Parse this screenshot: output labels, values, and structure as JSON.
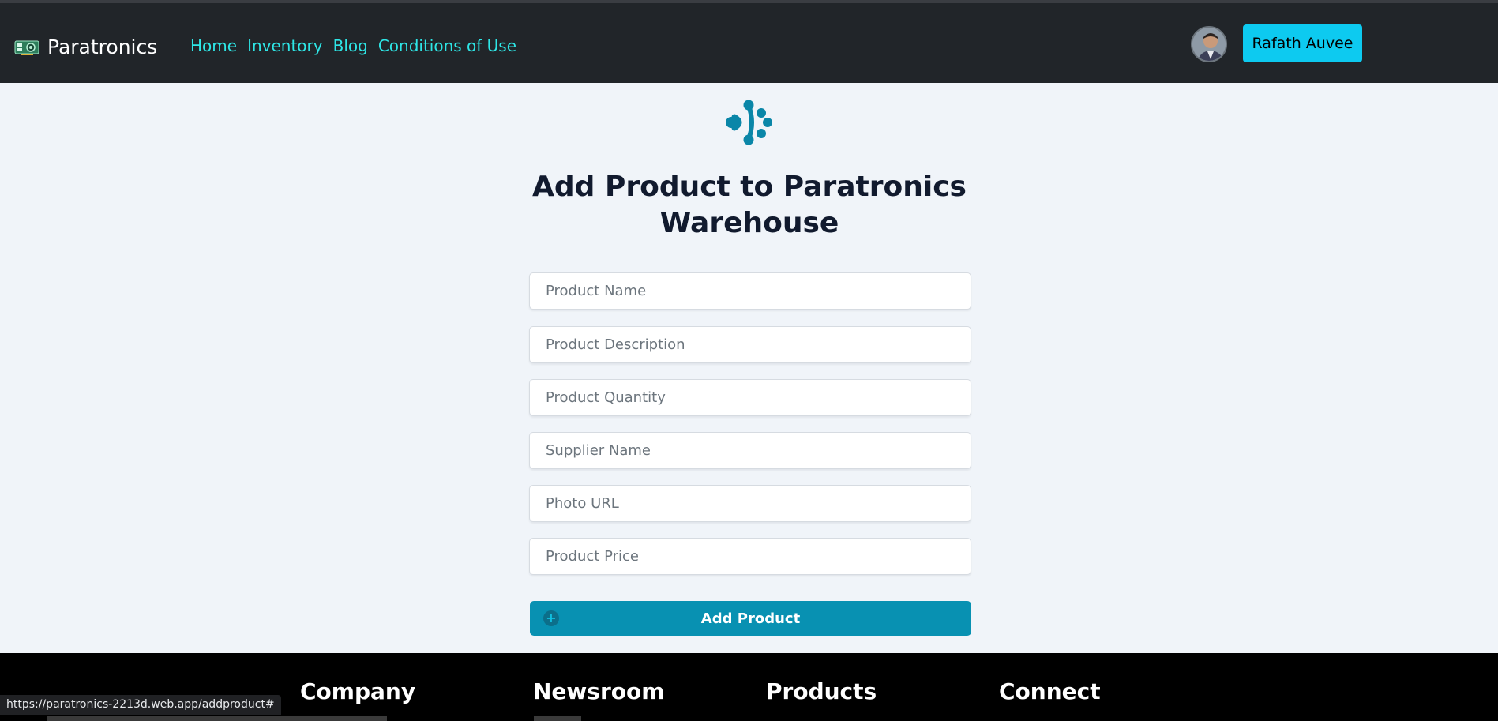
{
  "brand": {
    "name": "Paratronics"
  },
  "nav": {
    "links": [
      "Home",
      "Inventory",
      "Blog",
      "Conditions of Use"
    ]
  },
  "user": {
    "name": "Rafath Auvee"
  },
  "page": {
    "title": "Add Product to Paratronics Warehouse"
  },
  "form": {
    "fields": [
      {
        "placeholder": "Product Name"
      },
      {
        "placeholder": "Product Description"
      },
      {
        "placeholder": "Product Quantity"
      },
      {
        "placeholder": "Supplier Name"
      },
      {
        "placeholder": "Photo URL"
      },
      {
        "placeholder": "Product Price"
      }
    ],
    "submit_label": "Add Product"
  },
  "footer": {
    "columns": [
      "Company",
      "Newsroom",
      "Products",
      "Connect"
    ]
  },
  "status_bar": {
    "url": "https://paratronics-2213d.web.app/addproduct#"
  },
  "colors": {
    "navbar": "#212529",
    "nav_link": "#2ee6e6",
    "user_button": "#0dcaf0",
    "submit_button": "#0891b2",
    "footer": "#000000",
    "page_bg": "#f0f4f9"
  },
  "icons": [
    "circuit-board-icon",
    "node-logo-icon",
    "user-avatar",
    "plus-circle-icon"
  ]
}
